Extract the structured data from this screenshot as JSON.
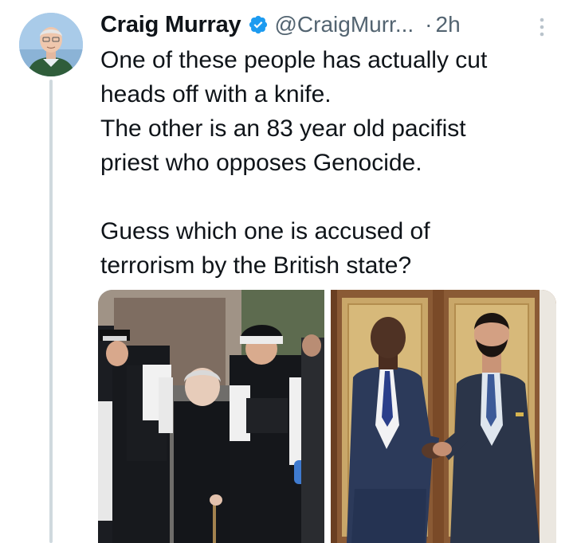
{
  "tweet": {
    "author": {
      "display_name": "Craig Murray",
      "handle": "@CraigMurr...",
      "verified": true,
      "avatar_icon": "user-avatar"
    },
    "separator": "·",
    "time": "2h",
    "more_icon": "more-vertical-icon",
    "text": "One of these people has actually cut\nheads off with a knife.\nThe other is an 83 year old pacifist\npriest who opposes Genocide.\n\nGuess which one is accused of\nterrorism by the British state?",
    "media": [
      {
        "kind": "photo"
      },
      {
        "kind": "photo"
      }
    ]
  },
  "colors": {
    "text_primary": "#0f1419",
    "text_secondary": "#536471",
    "verified_blue": "#1d9bf0",
    "thread_line": "#cfd9de"
  }
}
